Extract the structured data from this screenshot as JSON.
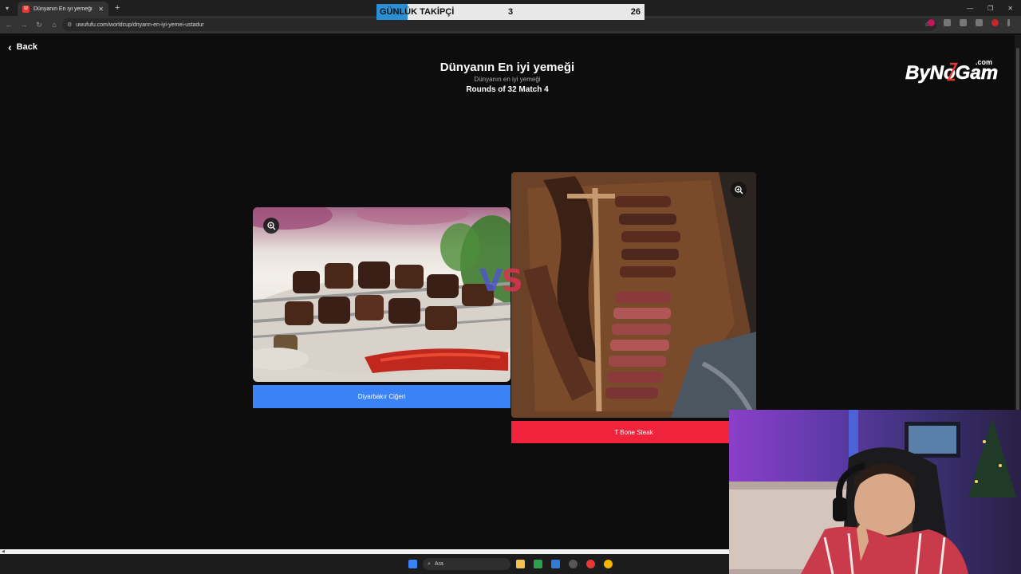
{
  "browser": {
    "tab_title": "Dünyanın En iyi yemeği | UwUf...",
    "favicon_letter": "U",
    "url": "uwufufu.com/worldcup/dnyann-en-iyi-yemei-ustadur"
  },
  "overlay": {
    "label": "GÜNLÜK TAKİPÇİ",
    "current": "3",
    "goal": "26",
    "progress_fraction": 0.115
  },
  "page": {
    "back_label": "Back",
    "title": "Dünyanın En iyi yemeği",
    "subtitle": "Dünyanın en iyi yemeği",
    "round_info": "Rounds of 32 Match 4",
    "logo_text": "ByNoGame",
    "logo_suffix": ".com"
  },
  "match": {
    "vs_v": "V",
    "vs_s": "S",
    "left": {
      "label": "Diyarbakır Ciğeri",
      "color": "#3b82f6"
    },
    "right": {
      "label": "T Bone Steak",
      "color": "#ef233c"
    }
  },
  "taskbar": {
    "search_placeholder": "Ara"
  }
}
